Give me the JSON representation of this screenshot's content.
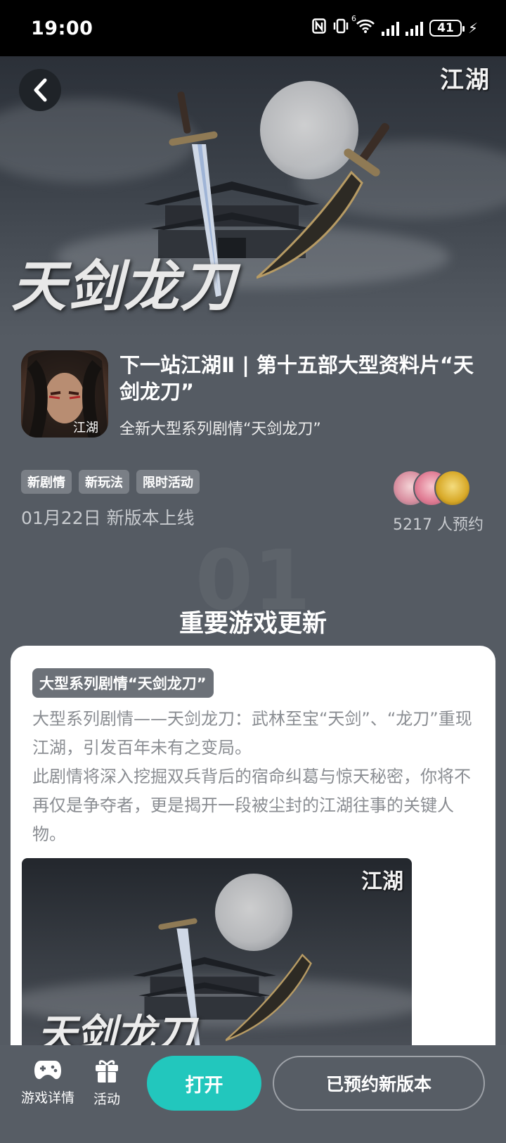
{
  "status_bar": {
    "time": "19:00",
    "network_sup": "6",
    "battery": "41"
  },
  "hero": {
    "logo": "江湖",
    "calligraphy": "天剑龙刀"
  },
  "app": {
    "title": "下一站江湖Ⅱ | 第十五部大型资料片“天剑龙刀”",
    "subtitle": "全新大型系列剧情“天剑龙刀”",
    "tags": [
      "新剧情",
      "新玩法",
      "限时活动"
    ],
    "release_date": "01月22日 新版本上线",
    "reserve_count": "5217 人预约"
  },
  "section": {
    "number": "01",
    "title": "重要游戏更新"
  },
  "card": {
    "tag": "大型系列剧情“天剑龙刀”",
    "paragraph1": "大型系列剧情——天剑龙刀：武林至宝“天剑”、“龙刀”重现江湖，引发百年未有之变局。",
    "paragraph2": "此剧情将深入挖掘双兵背后的宿命纠葛与惊天秘密，你将不再仅是争夺者，更是揭开一段被尘封的江湖往事的关键人物。",
    "image_logo": "江湖",
    "image_calligraphy": "天剑龙刀"
  },
  "bottom_bar": {
    "game_details_label": "游戏详情",
    "activity_label": "活动",
    "open_label": "打开",
    "reserved_label": "已预约新版本"
  },
  "colors": {
    "page_bg": "#555b63",
    "accent": "#22c7bd",
    "card_bg": "#ffffff",
    "tag_bg": "#7a7f86"
  }
}
